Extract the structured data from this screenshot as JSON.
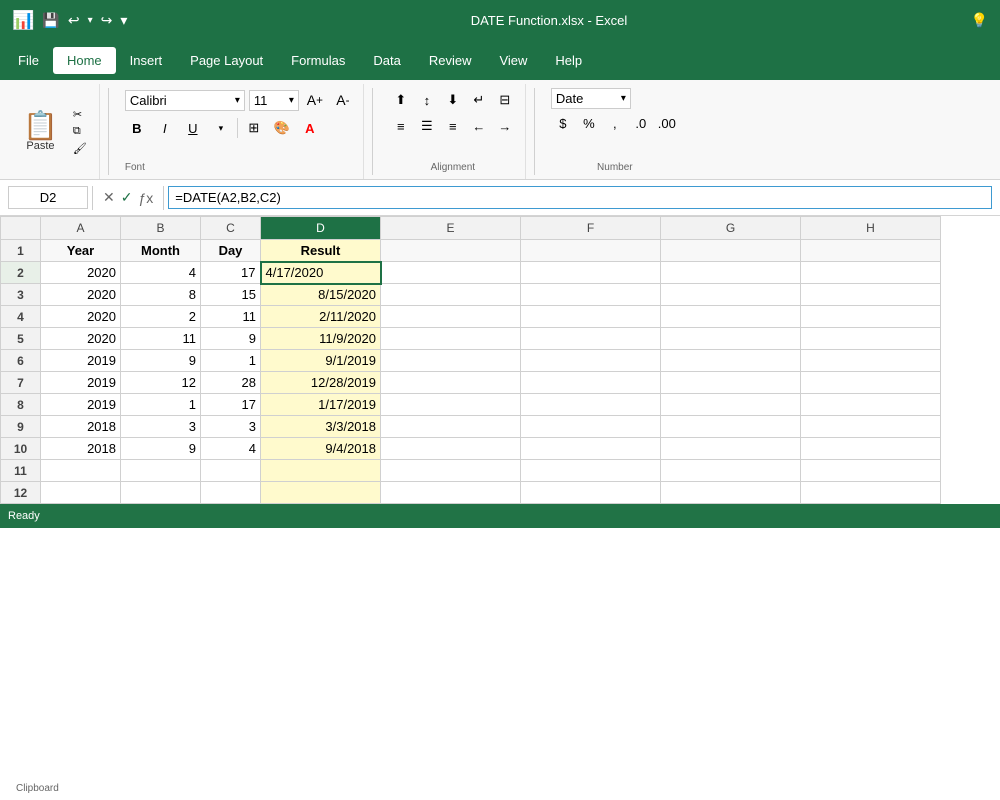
{
  "titleBar": {
    "title": "DATE Function.xlsx  -  Excel",
    "saveIcon": "💾",
    "undoIcon": "↩",
    "redoIcon": "↪",
    "moreIcon": "▾",
    "lightbulbIcon": "💡"
  },
  "menuBar": {
    "items": [
      "File",
      "Home",
      "Insert",
      "Page Layout",
      "Formulas",
      "Data",
      "Review",
      "View",
      "Help"
    ],
    "active": "Home"
  },
  "ribbon": {
    "clipboard": {
      "label": "Clipboard",
      "paste": "Paste",
      "cut": "✂",
      "copy": "⧉",
      "formatPainter": "🖌"
    },
    "font": {
      "label": "Font",
      "name": "Calibri",
      "size": "11"
    },
    "alignment": {
      "label": "Alignment"
    },
    "number": {
      "label": "Number",
      "format": "Date"
    }
  },
  "formulaBar": {
    "cellRef": "D2",
    "formula": "=DATE(A2,B2,C2)"
  },
  "columns": {
    "headers": [
      "",
      "A",
      "B",
      "C",
      "D",
      "E",
      "F",
      "G",
      "H"
    ],
    "widths": [
      40,
      80,
      80,
      60,
      120,
      140,
      140,
      140,
      140
    ]
  },
  "rows": [
    {
      "num": 1,
      "cells": [
        "Year",
        "Month",
        "Day",
        "Result",
        "",
        "",
        "",
        ""
      ]
    },
    {
      "num": 2,
      "cells": [
        "2020",
        "4",
        "17",
        "4/17/2020",
        "",
        "",
        "",
        ""
      ]
    },
    {
      "num": 3,
      "cells": [
        "2020",
        "8",
        "15",
        "8/15/2020",
        "",
        "",
        "",
        ""
      ]
    },
    {
      "num": 4,
      "cells": [
        "2020",
        "2",
        "11",
        "2/11/2020",
        "",
        "",
        "",
        ""
      ]
    },
    {
      "num": 5,
      "cells": [
        "2020",
        "11",
        "9",
        "11/9/2020",
        "",
        "",
        "",
        ""
      ]
    },
    {
      "num": 6,
      "cells": [
        "2019",
        "9",
        "1",
        "9/1/2019",
        "",
        "",
        "",
        ""
      ]
    },
    {
      "num": 7,
      "cells": [
        "2019",
        "12",
        "28",
        "12/28/2019",
        "",
        "",
        "",
        ""
      ]
    },
    {
      "num": 8,
      "cells": [
        "2019",
        "1",
        "17",
        "1/17/2019",
        "",
        "",
        "",
        ""
      ]
    },
    {
      "num": 9,
      "cells": [
        "2018",
        "3",
        "3",
        "3/3/2018",
        "",
        "",
        "",
        ""
      ]
    },
    {
      "num": 10,
      "cells": [
        "2018",
        "9",
        "4",
        "9/4/2018",
        "",
        "",
        "",
        ""
      ]
    },
    {
      "num": 11,
      "cells": [
        "",
        "",
        "",
        "",
        "",
        "",
        "",
        ""
      ]
    },
    {
      "num": 12,
      "cells": [
        "",
        "",
        "",
        "",
        "",
        "",
        "",
        ""
      ]
    }
  ],
  "statusBar": {
    "ready": "Ready"
  }
}
